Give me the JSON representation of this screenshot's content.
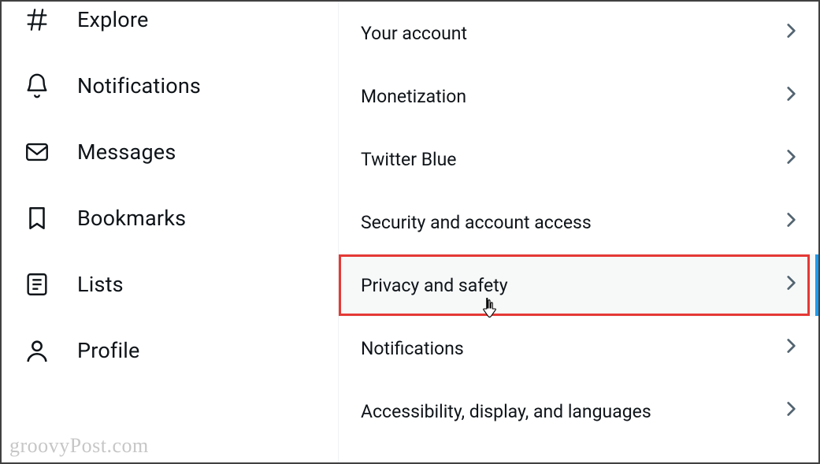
{
  "sidebar": {
    "items": [
      {
        "label": "Explore",
        "name": "nav-explore",
        "icon": "hash-icon"
      },
      {
        "label": "Notifications",
        "name": "nav-notifications",
        "icon": "bell-icon"
      },
      {
        "label": "Messages",
        "name": "nav-messages",
        "icon": "envelope-icon"
      },
      {
        "label": "Bookmarks",
        "name": "nav-bookmarks",
        "icon": "bookmark-icon"
      },
      {
        "label": "Lists",
        "name": "nav-lists",
        "icon": "list-icon"
      },
      {
        "label": "Profile",
        "name": "nav-profile",
        "icon": "profile-icon"
      }
    ]
  },
  "settings": {
    "items": [
      {
        "label": "Your account",
        "name": "settings-your-account"
      },
      {
        "label": "Monetization",
        "name": "settings-monetization"
      },
      {
        "label": "Twitter Blue",
        "name": "settings-twitter-blue"
      },
      {
        "label": "Security and account access",
        "name": "settings-security-account-access"
      },
      {
        "label": "Privacy and safety",
        "name": "settings-privacy-safety",
        "hovered": true,
        "highlighted": true
      },
      {
        "label": "Notifications",
        "name": "settings-notifications"
      },
      {
        "label": "Accessibility, display, and languages",
        "name": "settings-accessibility-display-languages"
      }
    ]
  },
  "watermark": "groovyPost.com"
}
